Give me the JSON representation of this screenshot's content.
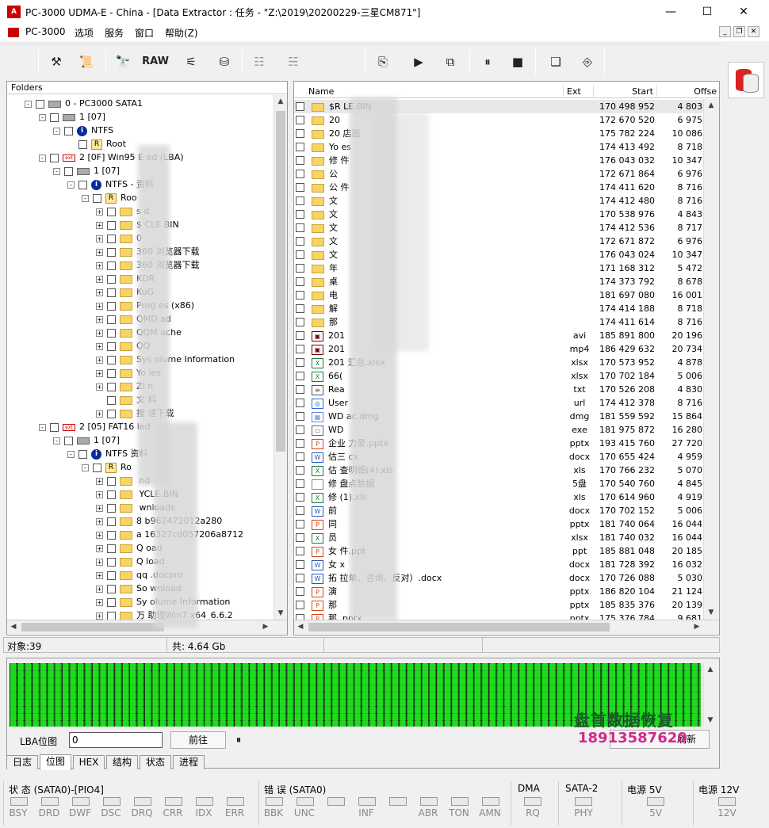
{
  "window": {
    "title": "PC-3000 UDMA-E - China - [Data Extractor : 任务 - \"Z:\\2019\\20200229-三星CM871\"]",
    "app_icon": "A",
    "minimize": "—",
    "maximize": "☐",
    "close": "✕"
  },
  "menu": [
    "PC-3000",
    "选项",
    "服务",
    "窗口",
    "帮助(Z)"
  ],
  "toolbar": {
    "raw_label": "RAW"
  },
  "folders": {
    "header": "Folders",
    "rows": [
      {
        "t": "0 - PC3000 SATA1"
      },
      {
        "t": "1 [07]"
      },
      {
        "t": "NTFS"
      },
      {
        "t": "Root"
      },
      {
        "t": "2 [0F] Win95 E        ed  (LBA)"
      },
      {
        "t": "1 [07]"
      },
      {
        "t": "NTFS -        资料"
      },
      {
        "t": "Roo"
      },
      {
        "t": "s        d"
      },
      {
        "t": "$        CLE.BIN"
      },
      {
        "t": "0"
      },
      {
        "t": "360        浏览器下载"
      },
      {
        "t": "360        浏览器下载"
      },
      {
        "t": "KDR"
      },
      {
        "t": "KuG"
      },
      {
        "t": "Prog        es (x86)"
      },
      {
        "t": "QMD        ad"
      },
      {
        "t": "QQM        ache"
      },
      {
        "t": "QQ"
      },
      {
        "t": "Sys        olume Information"
      },
      {
        "t": "Yo        les"
      },
      {
        "t": "ZI        n"
      },
      {
        "t": "文        料"
      },
      {
        "t": "搜        速下载"
      },
      {
        "t": "2 [05] FAT16        led"
      },
      {
        "t": "1 [07]"
      },
      {
        "t": "NTFS        资料"
      },
      {
        "t": "Ro"
      },
      {
        "t": "        nd"
      },
      {
        "t": "        YCLE.BIN"
      },
      {
        "t": "        wnloads"
      },
      {
        "t": "8        b962472012a280"
      },
      {
        "t": "a        16327cd057206a8712"
      },
      {
        "t": "Q        oad"
      },
      {
        "t": "Q        load"
      },
      {
        "t": "qq        .docpro"
      },
      {
        "t": "So        wnload"
      },
      {
        "t": "Sy        olume Information"
      },
      {
        "t": "万        助理Win7.x64_6.6.2"
      }
    ]
  },
  "files": {
    "headers": {
      "name": "Name",
      "ext": "Ext",
      "start": "Start",
      "offset": "Offse"
    },
    "rows": [
      {
        "name": "$R        LE.BIN",
        "ext": "",
        "start": "170 498 952",
        "off": "4 803"
      },
      {
        "name": "20        ",
        "ext": "",
        "start": "172 670 520",
        "off": "6 975"
      },
      {
        "name": "20        店面",
        "ext": "",
        "start": "175 782 224",
        "off": "10 086"
      },
      {
        "name": "Yo        es",
        "ext": "",
        "start": "174 413 492",
        "off": "8 718"
      },
      {
        "name": "修        件",
        "ext": "",
        "start": "176 043 032",
        "off": "10 347"
      },
      {
        "name": "公",
        "ext": "",
        "start": "172 671 864",
        "off": "6 976"
      },
      {
        "name": "公        件",
        "ext": "",
        "start": "174 411 620",
        "off": "8 716"
      },
      {
        "name": "文",
        "ext": "",
        "start": "174 412 480",
        "off": "8 716"
      },
      {
        "name": "文",
        "ext": "",
        "start": "170 538 976",
        "off": "4 843"
      },
      {
        "name": "文",
        "ext": "",
        "start": "174 412 536",
        "off": "8 717"
      },
      {
        "name": "文",
        "ext": "",
        "start": "172 671 872",
        "off": "6 976"
      },
      {
        "name": "文",
        "ext": "",
        "start": "176 043 024",
        "off": "10 347"
      },
      {
        "name": "年",
        "ext": "",
        "start": "171 168 312",
        "off": "5 472"
      },
      {
        "name": "桌",
        "ext": "",
        "start": "174 373 792",
        "off": "8 678"
      },
      {
        "name": "电",
        "ext": "",
        "start": "181 697 080",
        "off": "16 001"
      },
      {
        "name": "解",
        "ext": "",
        "start": "174 414 188",
        "off": "8 718"
      },
      {
        "name": "那",
        "ext": "",
        "start": "174 411 614",
        "off": "8 716"
      },
      {
        "name": "201",
        "ext": "avi",
        "start": "185 891 800",
        "off": "20 196"
      },
      {
        "name": "201",
        "ext": "mp4",
        "start": "186 429 632",
        "off": "20 734"
      },
      {
        "name": "201        汇总.xlsx",
        "ext": "xlsx",
        "start": "170 573 952",
        "off": "4 878"
      },
      {
        "name": "66(",
        "ext": "xlsx",
        "start": "170 702 184",
        "off": "5 006"
      },
      {
        "name": "Rea",
        "ext": "txt",
        "start": "170 526 208",
        "off": "4 830"
      },
      {
        "name": "User",
        "ext": "url",
        "start": "174 412 378",
        "off": "8 716"
      },
      {
        "name": "WD        ac.dmg",
        "ext": "dmg",
        "start": "181 559 592",
        "off": "15 864"
      },
      {
        "name": "WD",
        "ext": "exe",
        "start": "181 975 872",
        "off": "16 280"
      },
      {
        "name": "企业        力爱.pptx",
        "ext": "pptx",
        "start": "193 415 760",
        "off": "27 720"
      },
      {
        "name": "估三        cx",
        "ext": "docx",
        "start": "170 655 424",
        "off": "4 959"
      },
      {
        "name": "估        查明细(4).xls",
        "ext": "xls",
        "start": "170 766 232",
        "off": "5 070"
      },
      {
        "name": "修        盘点数据",
        "ext": "5盘",
        "start": "170 540 760",
        "off": "4 845"
      },
      {
        "name": "修        (1).xls",
        "ext": "xls",
        "start": "170 614 960",
        "off": "4 919"
      },
      {
        "name": "前",
        "ext": "docx",
        "start": "170 702 152",
        "off": "5 006"
      },
      {
        "name": "同",
        "ext": "pptx",
        "start": "181 740 064",
        "off": "16 044"
      },
      {
        "name": "员",
        "ext": "xlsx",
        "start": "181 740 032",
        "off": "16 044"
      },
      {
        "name": "女        件.ppt",
        "ext": "ppt",
        "start": "185 881 048",
        "off": "20 185"
      },
      {
        "name": "女        x",
        "ext": "docx",
        "start": "181 728 392",
        "off": "16 032"
      },
      {
        "name": "拓        拉单、咨询、反对）.docx",
        "ext": "docx",
        "start": "170 726 088",
        "off": "5 030"
      },
      {
        "name": "演",
        "ext": "pptx",
        "start": "186 820 104",
        "off": "21 124"
      },
      {
        "name": "那",
        "ext": "pptx",
        "start": "185 835 376",
        "off": "20 139"
      },
      {
        "name": "那        .pptx",
        "ext": "pptx",
        "start": "175 376 784",
        "off": "9 681"
      }
    ]
  },
  "status": {
    "objects": "对象:39",
    "total": "共: 4.64 Gb"
  },
  "map": {
    "lba_label": "LBA位图",
    "lba_value": "0",
    "goto": "前往",
    "pause": "⏸",
    "refresh": "刷新",
    "watermark_line1": "盘首数据恢复",
    "watermark_line2": "18913587620"
  },
  "tabs": [
    "日志",
    "位图",
    "HEX",
    "结构",
    "状态",
    "进程"
  ],
  "indicators": {
    "status_group": "状 态 (SATA0)-[PIO4]",
    "status_leds": [
      "BSY",
      "DRD",
      "DWF",
      "DSC",
      "DRQ",
      "CRR",
      "IDX",
      "ERR"
    ],
    "error_group": "错 误 (SATA0)",
    "error_leds": [
      "BBK",
      "UNC",
      "",
      "INF",
      "",
      "ABR",
      "TON",
      "AMN"
    ],
    "dma_group": "DMA",
    "dma_led": "RQ",
    "sata_group": "SATA-2",
    "sata_led": "PHY",
    "p5_group": "电源 5V",
    "p5_led": "5V",
    "p12_group": "电源 12V",
    "p12_led": "12V"
  },
  "colors": {
    "map_green": "#21e621",
    "title_red": "#cc0000"
  }
}
